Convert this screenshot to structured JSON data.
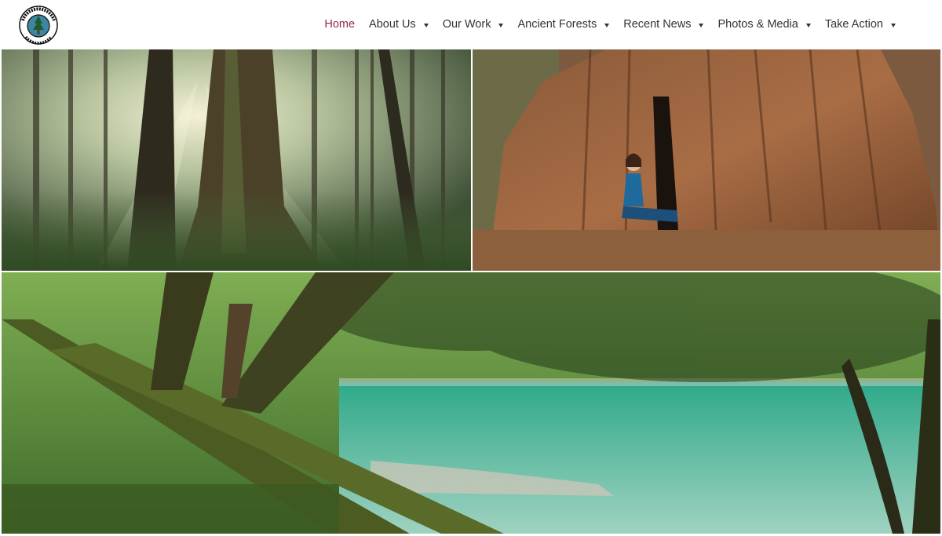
{
  "site": {
    "logo_text": "ANCIENT FOREST ALLIANCE"
  },
  "nav": {
    "items": [
      {
        "label": "Home",
        "active": true,
        "has_dropdown": false
      },
      {
        "label": "About Us",
        "active": false,
        "has_dropdown": true
      },
      {
        "label": "Our Work",
        "active": false,
        "has_dropdown": true
      },
      {
        "label": "Ancient Forests",
        "active": false,
        "has_dropdown": true
      },
      {
        "label": "Recent News",
        "active": false,
        "has_dropdown": true
      },
      {
        "label": "Photos & Media",
        "active": false,
        "has_dropdown": true
      },
      {
        "label": "Take Action",
        "active": false,
        "has_dropdown": true
      }
    ]
  },
  "colors": {
    "nav_active": "#8c2a4c",
    "nav_text": "#333333"
  },
  "gallery": {
    "images": [
      {
        "subject": "sunlit-old-growth-forest"
      },
      {
        "subject": "woman-sitting-in-hollow-cedar-stump"
      },
      {
        "subject": "mossy-fallen-trees-over-emerald-river"
      }
    ]
  }
}
